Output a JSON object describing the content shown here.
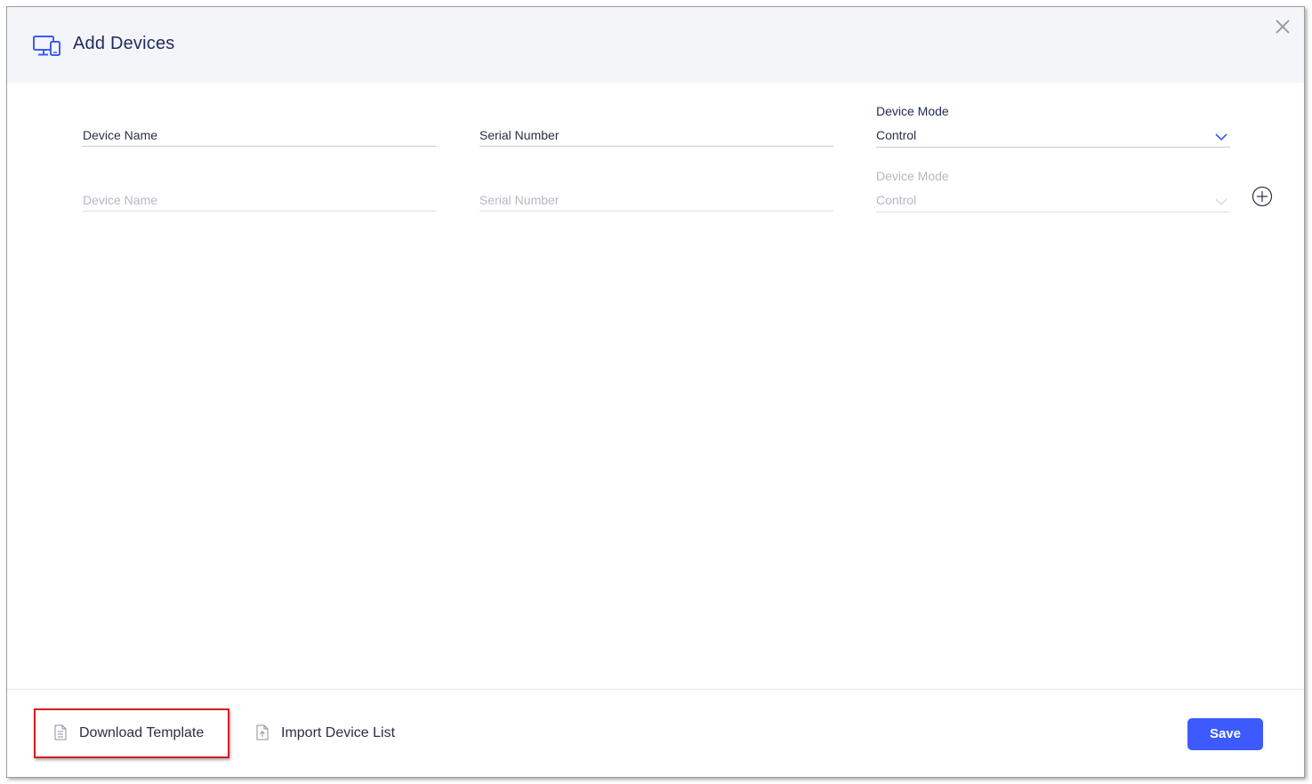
{
  "dialog": {
    "title": "Add Devices",
    "icon": "devices-icon",
    "close_icon": "close-icon"
  },
  "rows": [
    {
      "device_name": "Device Name",
      "serial_number": "Serial Number",
      "mode_label": "Device Mode",
      "mode_value": "Control",
      "state": "active"
    },
    {
      "device_name": "Device Name",
      "serial_number": "Serial Number",
      "mode_label": "Device Mode",
      "mode_value": "Control",
      "state": "placeholder"
    }
  ],
  "add_row_icon": "plus-circle-icon",
  "footer": {
    "download_label": "Download Template",
    "download_icon": "document-icon",
    "import_label": "Import Device List",
    "import_icon": "upload-file-icon",
    "save_label": "Save"
  },
  "colors": {
    "accent": "#3d5afe",
    "highlight": "#d9191f",
    "header_bg": "#f4f5f9",
    "title": "#1f2a5a"
  }
}
